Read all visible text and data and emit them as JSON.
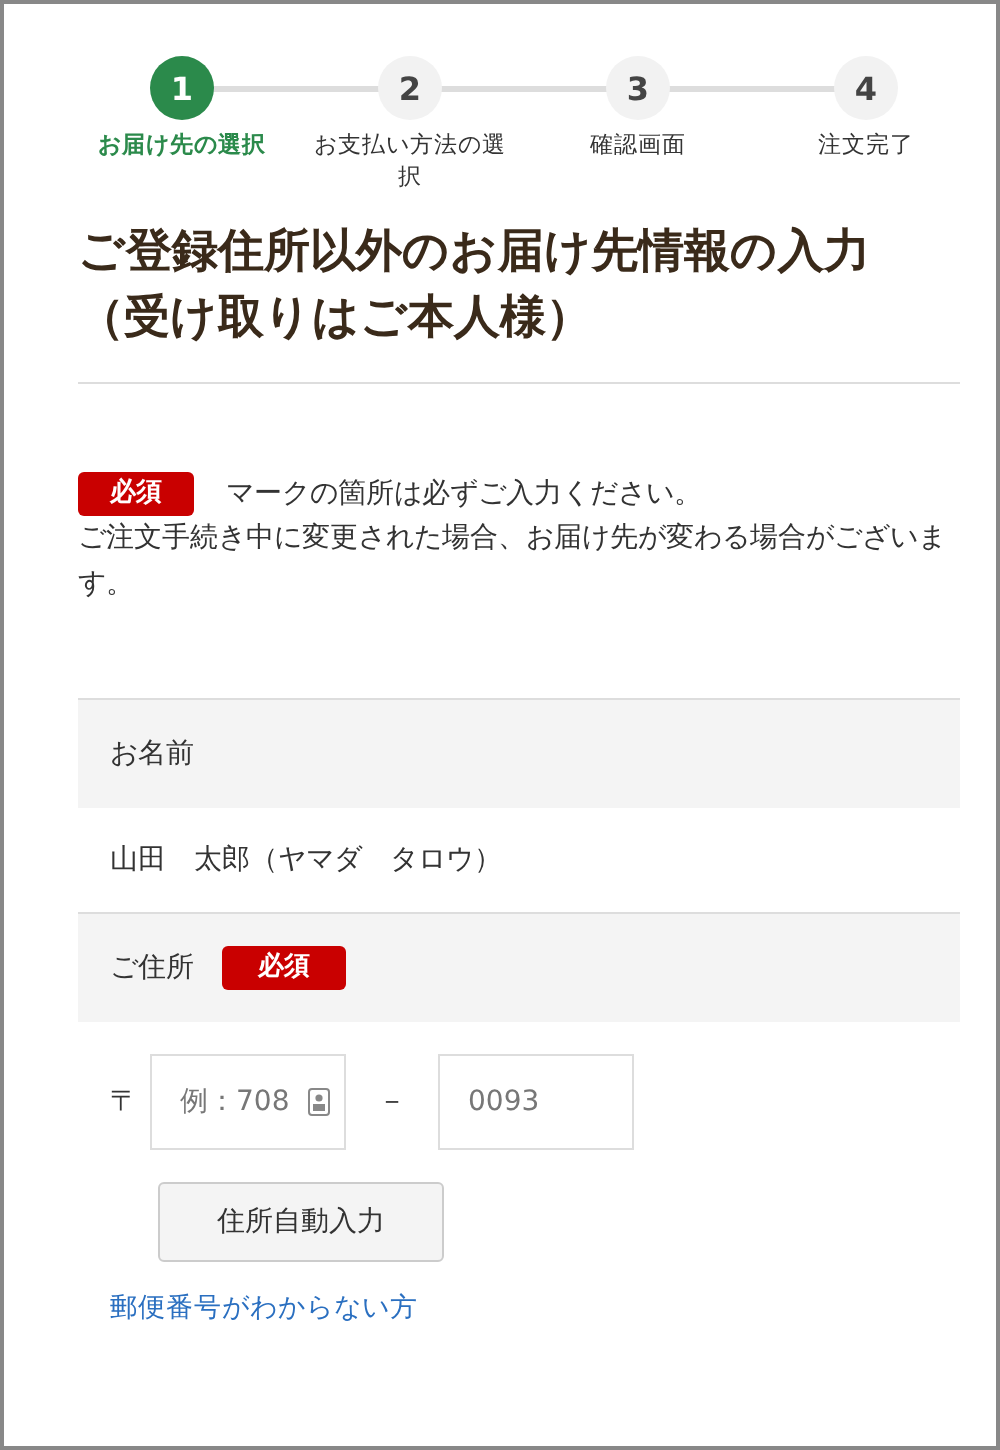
{
  "steps": [
    {
      "number": "1",
      "label": "お届け先の選択",
      "selected": true
    },
    {
      "number": "2",
      "label": "お支払い方法の選択",
      "selected": false
    },
    {
      "number": "3",
      "label": "確認画面",
      "selected": false
    },
    {
      "number": "4",
      "label": "注文完了",
      "selected": false
    }
  ],
  "heading": "ご登録住所以外のお届け先情報の入力（受け取りはご本人様）",
  "notice": {
    "badge": "必須",
    "line": "マークの箇所は必ずご入力ください。",
    "text": "ご注文手続き中に変更された場合、お届け先が変わる場合がございます。"
  },
  "name_section": {
    "label": "お名前",
    "value": "山田　太郎（ヤマダ　タロウ）"
  },
  "address_section": {
    "label": "ご住所",
    "badge": "必須",
    "postal_mark": "〒",
    "zip1_placeholder": "例：708",
    "separator": "－",
    "zip2_placeholder": "0093",
    "autofill_button": "住所自動入力",
    "help_link": "郵便番号がわからない方"
  }
}
